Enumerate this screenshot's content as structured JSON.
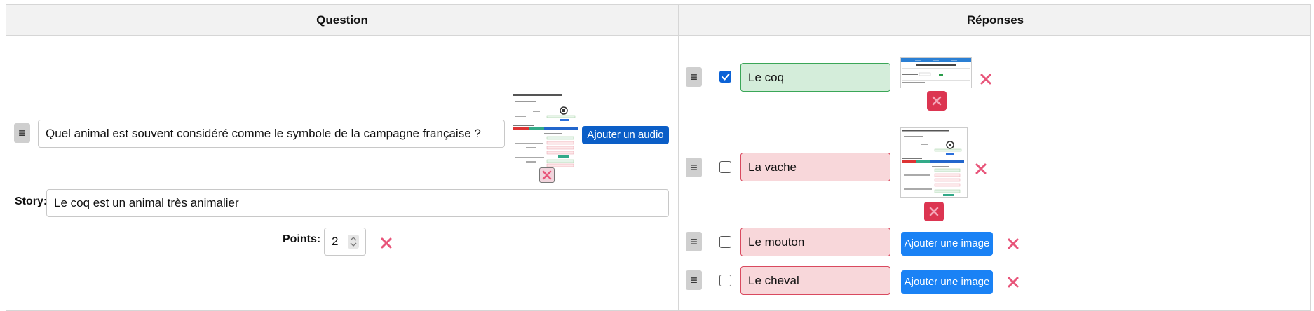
{
  "header": {
    "question_label": "Question",
    "reponses_label": "Réponses"
  },
  "question": {
    "drag_icon": "≡",
    "text": "Quel animal est souvent considéré comme le symbole de la campagne française ?",
    "image_icon": "question-image-thumbnail",
    "add_audio_label": "Ajouter un audio",
    "story_label": "Story:",
    "story_text": "Le coq est un animal très animalier",
    "points_label": "Points:",
    "points_value": "2"
  },
  "answers": [
    {
      "drag_icon": "≡",
      "checked": true,
      "text": "Le coq",
      "has_image": true,
      "correct": true
    },
    {
      "drag_icon": "≡",
      "checked": false,
      "text": "La vache",
      "has_image": true,
      "correct": false
    },
    {
      "drag_icon": "≡",
      "checked": false,
      "text": "Le mouton",
      "has_image": false,
      "add_image_label": "Ajouter une image",
      "correct": false
    },
    {
      "drag_icon": "≡",
      "checked": false,
      "text": "Le cheval",
      "has_image": false,
      "add_image_label": "Ajouter une image",
      "correct": false
    }
  ],
  "colors": {
    "accent_blue": "#0b5ec7",
    "add_image_blue": "#1a82f5",
    "delete_pink": "#e8557a",
    "delete_red_bg": "#dc3551",
    "correct_green_bg": "#d4edda",
    "wrong_red_bg": "#f8d7da"
  }
}
